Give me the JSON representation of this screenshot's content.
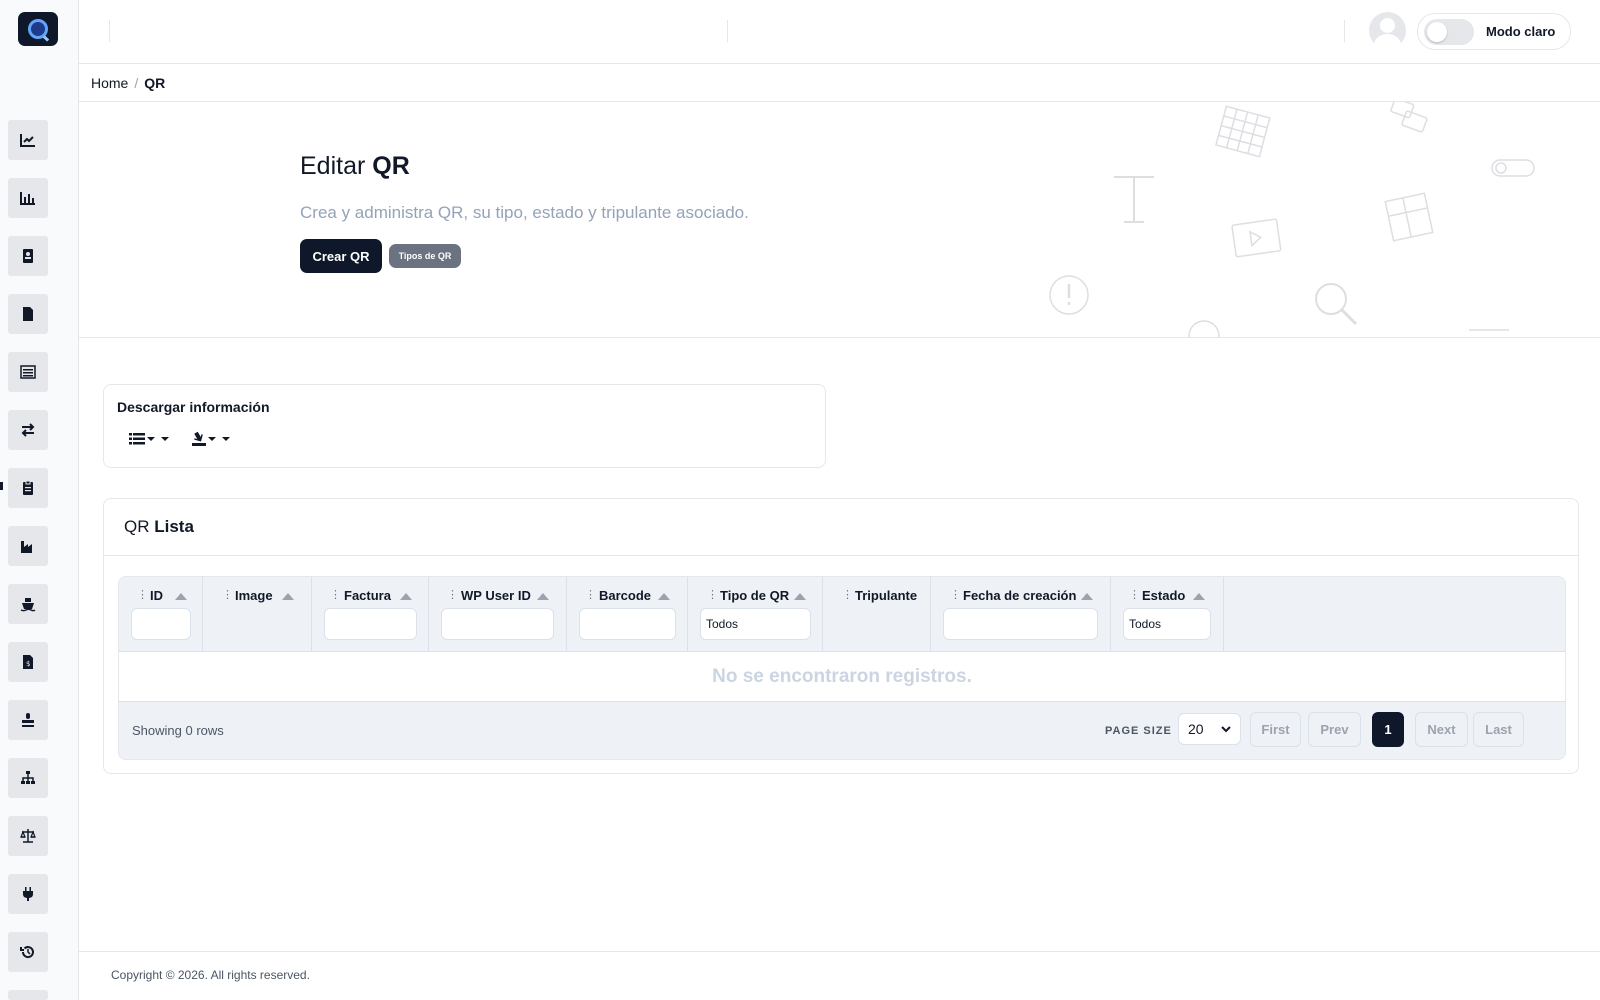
{
  "topbar": {
    "mode_label": "Modo claro",
    "icons": [
      "avatar-icon",
      "toggle-switch"
    ]
  },
  "sidebar": {
    "items": [
      {
        "icon": "line-chart-icon"
      },
      {
        "icon": "bar-chart-icon"
      },
      {
        "icon": "contact-book-icon"
      },
      {
        "icon": "file-icon"
      },
      {
        "icon": "list-icon"
      },
      {
        "icon": "transfer-arrows-icon"
      },
      {
        "icon": "clipboard-icon"
      },
      {
        "icon": "factory-icon"
      },
      {
        "icon": "ship-icon"
      },
      {
        "icon": "invoice-dollar-icon"
      },
      {
        "icon": "stamp-icon"
      },
      {
        "icon": "sitemap-icon"
      },
      {
        "icon": "scale-icon"
      },
      {
        "icon": "plug-icon"
      },
      {
        "icon": "history-icon"
      }
    ]
  },
  "breadcrumb": {
    "home": "Home",
    "separator": "/",
    "current": "QR"
  },
  "hero": {
    "title_prefix": "Editar",
    "title_strong": "QR",
    "subtitle": "Crea y administra QR, su tipo, estado y tripulante asociado.",
    "create_button": "Crear QR",
    "types_button": "Tipos de QR"
  },
  "download": {
    "title": "Descargar información",
    "list_icon": "list-icon",
    "export_icon": "export-icon"
  },
  "qr_list": {
    "title_prefix": "QR",
    "title_strong": "Lista",
    "columns": [
      {
        "label": "ID",
        "filter": "input"
      },
      {
        "label": "Image",
        "filter": "none"
      },
      {
        "label": "Factura",
        "filter": "input"
      },
      {
        "label": "WP User ID",
        "filter": "input"
      },
      {
        "label": "Barcode",
        "filter": "input"
      },
      {
        "label": "Tipo de QR",
        "filter": "select",
        "value": "Todos"
      },
      {
        "label": "Tripulante",
        "filter": "none"
      },
      {
        "label": "Fecha de creación",
        "filter": "input"
      },
      {
        "label": "Estado",
        "filter": "select",
        "value": "Todos"
      }
    ],
    "empty_message": "No se encontraron registros.",
    "showing": "Showing 0 rows",
    "page_size_label": "PAGE SIZE",
    "page_size_value": "20",
    "pagination": {
      "first": "First",
      "prev": "Prev",
      "current": "1",
      "next": "Next",
      "last": "Last"
    }
  },
  "footer": {
    "copyright": "Copyright © 2026. All rights reserved."
  },
  "colors": {
    "primary_dark": "#0f172a",
    "muted_text": "#94a3b8",
    "grid_bg": "#eef2f7",
    "border": "#e5e7eb"
  }
}
